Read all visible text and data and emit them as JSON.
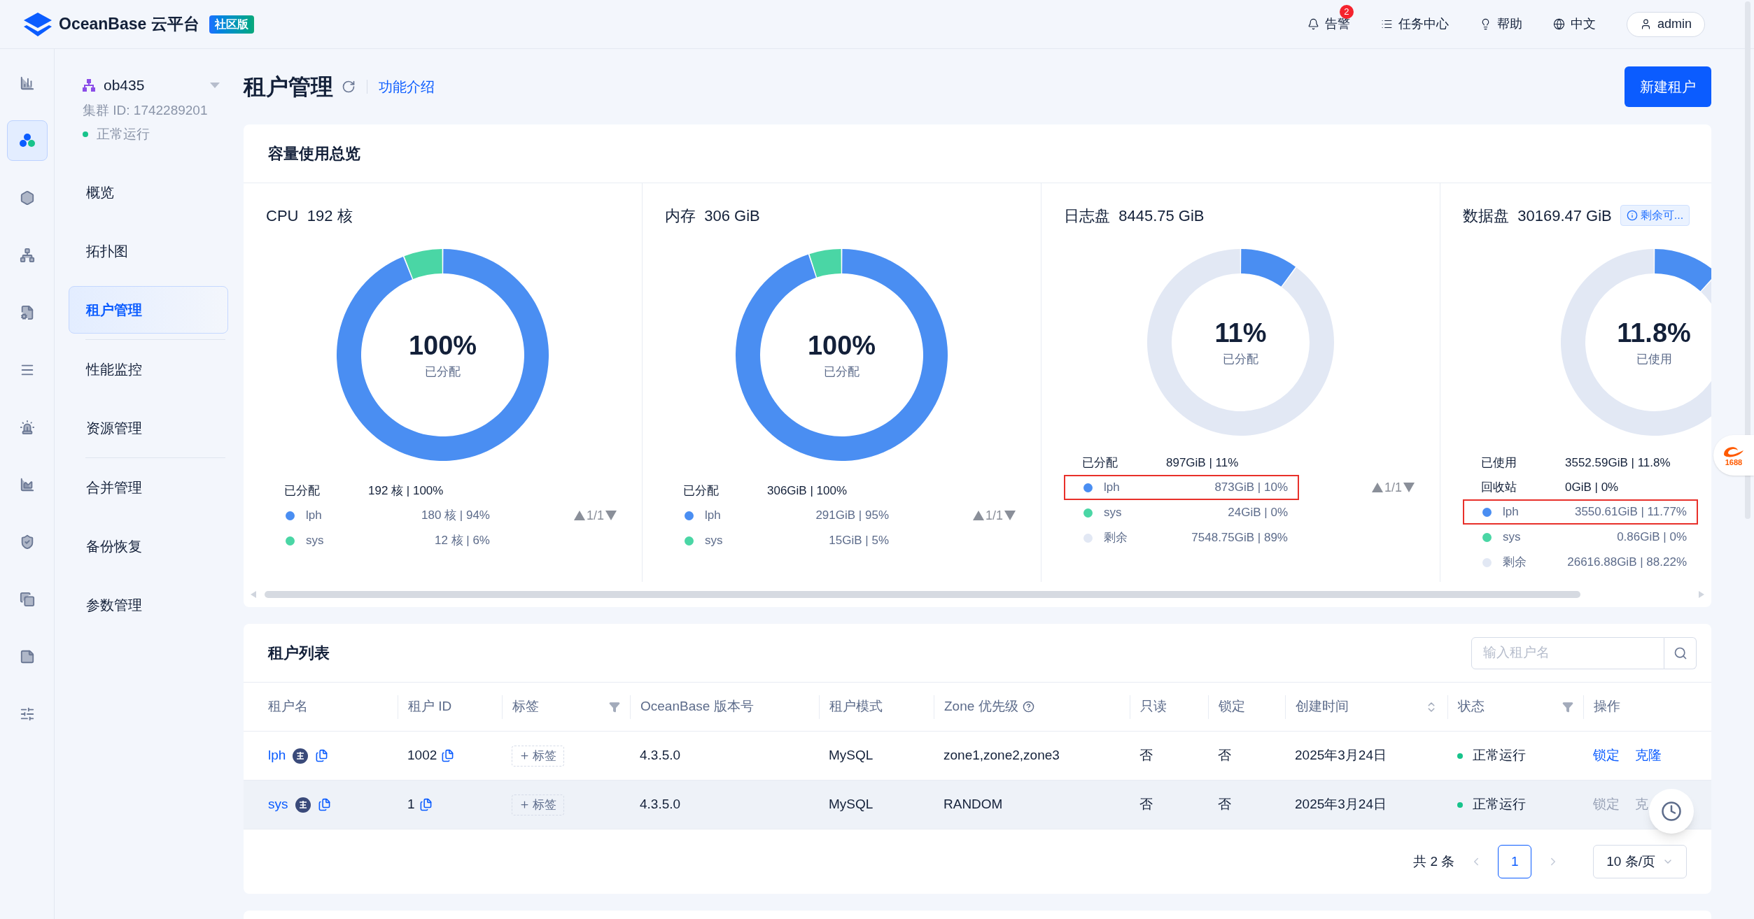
{
  "brand": {
    "name": "OceanBase 云平台",
    "badge": "社区版"
  },
  "topbar": [
    {
      "kind": "alert",
      "label": "告警",
      "count": "2"
    },
    {
      "kind": "tasks",
      "label": "任务中心"
    },
    {
      "kind": "help",
      "label": "帮助"
    },
    {
      "kind": "lang",
      "label": "中文"
    },
    {
      "kind": "user",
      "label": "admin"
    }
  ],
  "rail": [
    {
      "kind": "chart",
      "selected": false
    },
    {
      "kind": "cluster",
      "selected": true
    },
    {
      "kind": "hexagon",
      "selected": false
    },
    {
      "kind": "network",
      "selected": false
    },
    {
      "kind": "file",
      "selected": false
    },
    {
      "kind": "list",
      "selected": false
    },
    {
      "kind": "siren",
      "selected": false
    },
    {
      "kind": "area",
      "selected": false
    },
    {
      "kind": "shield",
      "selected": false
    },
    {
      "kind": "copy",
      "selected": false
    },
    {
      "kind": "note",
      "selected": false
    },
    {
      "kind": "sliders",
      "selected": false
    }
  ],
  "cluster": {
    "name": "ob435",
    "id_label": "集群 ID: 1742289201",
    "status": "正常运行"
  },
  "nav": [
    {
      "label": "概览",
      "selected": false
    },
    {
      "label": "拓扑图",
      "selected": false
    },
    {
      "label": "租户管理",
      "selected": true
    },
    {
      "label": "性能监控",
      "selected": false
    },
    {
      "label": "资源管理",
      "selected": false
    },
    {
      "label": "合并管理",
      "selected": false
    },
    {
      "label": "备份恢复",
      "selected": false
    },
    {
      "label": "参数管理",
      "selected": false
    }
  ],
  "page": {
    "title": "租户管理",
    "intro_link": "功能介绍",
    "create_button": "新建租户"
  },
  "capacity": {
    "title": "容量使用总览",
    "cards": [
      {
        "title": "CPU",
        "total": "192 核",
        "center_value": "100%",
        "center_label": "已分配",
        "pager": "1/1",
        "summary": [
          {
            "label": "已分配",
            "value": "192 核 | 100%"
          }
        ],
        "items": [
          {
            "value": "180 核 | 94%",
            "color": "#4a8ef2",
            "highlighted": false
          },
          {
            "value": "12 核 | 6%",
            "color": "#4ad6a5",
            "highlighted": false
          }
        ],
        "chart_data": {
          "type": "donut",
          "legend": "bottom",
          "categories": [
            "lph",
            "sys"
          ],
          "values": [
            94,
            6
          ]
        }
      },
      {
        "title": "内存",
        "total": "306 GiB",
        "center_value": "100%",
        "center_label": "已分配",
        "pager": "1/1",
        "summary": [
          {
            "label": "已分配",
            "value": "306GiB | 100%"
          }
        ],
        "items": [
          {
            "value": "291GiB | 95%",
            "color": "#4a8ef2",
            "highlighted": false
          },
          {
            "value": "15GiB | 5%",
            "color": "#4ad6a5",
            "highlighted": false
          }
        ],
        "chart_data": {
          "type": "donut",
          "legend": "bottom",
          "categories": [
            "lph",
            "sys"
          ],
          "values": [
            95,
            5
          ]
        }
      },
      {
        "title": "日志盘",
        "total": "8445.75 GiB",
        "center_value": "11%",
        "center_label": "已分配",
        "pager": "1/1",
        "summary": [
          {
            "label": "已分配",
            "value": "897GiB | 11%"
          }
        ],
        "items": [
          {
            "value": "873GiB | 10%",
            "color": "#4a8ef2",
            "highlighted": true
          },
          {
            "value": "24GiB | 0%",
            "color": "#4ad6a5",
            "highlighted": false
          },
          {
            "value": "7548.75GiB | 89%",
            "color": "#e2e8f4",
            "highlighted": false
          }
        ],
        "chart_data": {
          "type": "donut",
          "legend": "bottom",
          "categories": [
            "lph",
            "sys",
            "剩余"
          ],
          "values": [
            10,
            0,
            89
          ]
        }
      },
      {
        "title": "数据盘",
        "total": "30169.47 GiB",
        "info_badge": "剩余可...",
        "center_value": "11.8%",
        "center_label": "已使用",
        "summary": [
          {
            "label": "已使用",
            "value": "3552.59GiB | 11.8%"
          },
          {
            "label": "回收站",
            "value": "0GiB | 0%"
          }
        ],
        "items": [
          {
            "value": "3550.61GiB | 11.77%",
            "color": "#4a8ef2",
            "highlighted": true
          },
          {
            "value": "0.86GiB | 0%",
            "color": "#4ad6a5",
            "highlighted": false
          },
          {
            "value": "26616.88GiB | 88.22%",
            "color": "#e2e8f4",
            "highlighted": false
          }
        ],
        "chart_data": {
          "type": "donut",
          "legend": "bottom",
          "categories": [
            "lph",
            "sys",
            "剩余"
          ],
          "values": [
            11.77,
            0,
            88.22
          ]
        }
      }
    ]
  },
  "tenants": {
    "title": "租户列表",
    "search_placeholder": "输入租户名",
    "columns": [
      {
        "label": "租户名"
      },
      {
        "label": "租户 ID"
      },
      {
        "label": "标签",
        "filter": true
      },
      {
        "label": "OceanBase 版本号"
      },
      {
        "label": "租户模式"
      },
      {
        "label": "Zone 优先级",
        "help": true
      },
      {
        "label": "只读"
      },
      {
        "label": "锁定"
      },
      {
        "label": "创建时间",
        "sort": true
      },
      {
        "label": "状态",
        "filter": true
      },
      {
        "label": "操作"
      }
    ],
    "rows": [
      {
        "name": "lph",
        "id": "1002",
        "tag_button": "标签",
        "version": "4.3.5.0",
        "mode": "MySQL",
        "zone": "zone1,zone2,zone3",
        "readonly": "否",
        "locked": "否",
        "created": "2025年3月24日",
        "status": "正常运行",
        "hovered": false,
        "actions": [
          {
            "label": "锁定",
            "disabled": false
          },
          {
            "label": "克隆",
            "disabled": false
          }
        ]
      },
      {
        "name": "sys",
        "id": "1",
        "tag_button": "标签",
        "version": "4.3.5.0",
        "mode": "MySQL",
        "zone": "RANDOM",
        "readonly": "否",
        "locked": "否",
        "created": "2025年3月24日",
        "status": "正常运行",
        "hovered": true,
        "actions": [
          {
            "label": "锁定",
            "disabled": true
          },
          {
            "label": "克",
            "disabled": true
          }
        ]
      }
    ],
    "pagination": {
      "total": "共 2 条",
      "pages": [
        {
          "label": "1",
          "selected": true
        }
      ],
      "page_size": "10 条/页"
    }
  },
  "side_widget": {
    "label": "1688"
  }
}
